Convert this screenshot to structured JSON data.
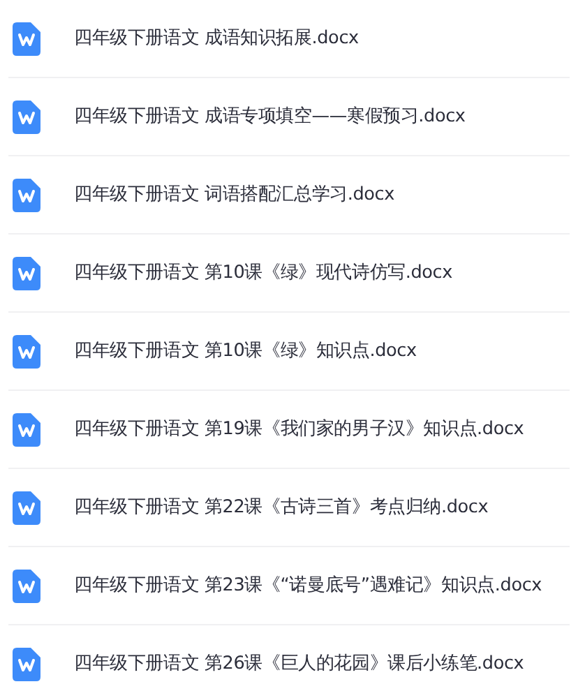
{
  "files": [
    {
      "name": "四年级下册语文 成语知识拓展.docx"
    },
    {
      "name": "四年级下册语文 成语专项填空——寒假预习.docx"
    },
    {
      "name": "四年级下册语文 词语搭配汇总学习.docx"
    },
    {
      "name": "四年级下册语文 第10课《绿》现代诗仿写.docx"
    },
    {
      "name": "四年级下册语文 第10课《绿》知识点.docx"
    },
    {
      "name": "四年级下册语文 第19课《我们家的男子汉》知识点.docx"
    },
    {
      "name": "四年级下册语文 第22课《古诗三首》考点归纳.docx"
    },
    {
      "name": "四年级下册语文 第23课《“诺曼底号”遇难记》知识点.docx"
    },
    {
      "name": "四年级下册语文 第26课《巨人的花园》课后小练笔.docx"
    }
  ]
}
